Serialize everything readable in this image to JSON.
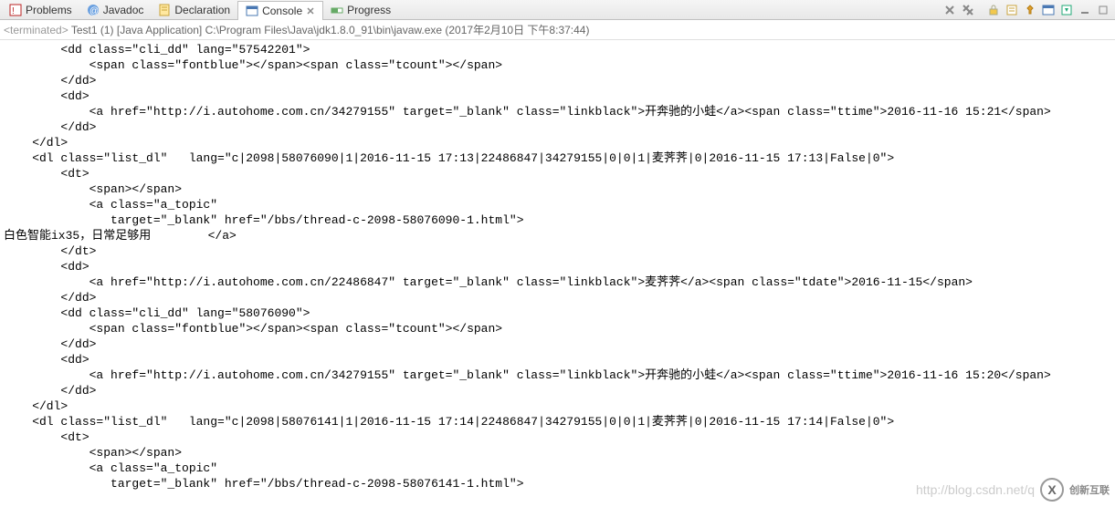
{
  "tabs": [
    {
      "label": "Problems",
      "icon": "problems-icon"
    },
    {
      "label": "Javadoc",
      "icon": "javadoc-icon"
    },
    {
      "label": "Declaration",
      "icon": "declaration-icon"
    },
    {
      "label": "Console",
      "icon": "console-icon",
      "active": true
    },
    {
      "label": "Progress",
      "icon": "progress-icon"
    }
  ],
  "status": {
    "terminated": "<terminated>",
    "run_name": "Test1 (1) [Java Application] C:\\Program Files\\Java\\jdk1.8.0_91\\bin\\javaw.exe (2017年2月10日 下午8:37:44)"
  },
  "console_text": "        <dd class=\"cli_dd\" lang=\"57542201\">\n            <span class=\"fontblue\"></span><span class=\"tcount\"></span>\n        </dd>\n        <dd>\n            <a href=\"http://i.autohome.com.cn/34279155\" target=\"_blank\" class=\"linkblack\">开奔驰的小蛙</a><span class=\"ttime\">2016-11-16 15:21</span>\n        </dd>\n    </dl>\n    <dl class=\"list_dl\"   lang=\"c|2098|58076090|1|2016-11-15 17:13|22486847|34279155|0|0|1|麦荠荠|0|2016-11-15 17:13|False|0\">\n        <dt>\n            <span></span>\n            <a class=\"a_topic\"\n               target=\"_blank\" href=\"/bbs/thread-c-2098-58076090-1.html\">\n白色智能ix35，日常足够用        </a>\n        </dt>\n        <dd>\n            <a href=\"http://i.autohome.com.cn/22486847\" target=\"_blank\" class=\"linkblack\">麦荠荠</a><span class=\"tdate\">2016-11-15</span>\n        </dd>\n        <dd class=\"cli_dd\" lang=\"58076090\">\n            <span class=\"fontblue\"></span><span class=\"tcount\"></span>\n        </dd>\n        <dd>\n            <a href=\"http://i.autohome.com.cn/34279155\" target=\"_blank\" class=\"linkblack\">开奔驰的小蛙</a><span class=\"ttime\">2016-11-16 15:20</span>\n        </dd>\n    </dl>\n    <dl class=\"list_dl\"   lang=\"c|2098|58076141|1|2016-11-15 17:14|22486847|34279155|0|0|1|麦荠荠|0|2016-11-15 17:14|False|0\">\n        <dt>\n            <span></span>\n            <a class=\"a_topic\"\n               target=\"_blank\" href=\"/bbs/thread-c-2098-58076141-1.html\">",
  "watermark": {
    "url": "http://blog.csdn.net/q",
    "brand": "创新互联"
  }
}
